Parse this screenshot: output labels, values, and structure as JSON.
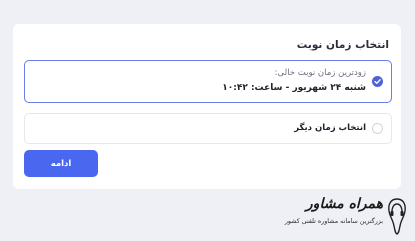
{
  "page": {
    "title": "انتخاب زمان نوبت"
  },
  "options": [
    {
      "subtitle": "زودترین زمان نوبت خالی:",
      "value": "شنبه ۲۴ شهریور - ساعت: ۱۰:۴۲",
      "selected": true
    },
    {
      "label": "انتخاب زمان دیگر",
      "selected": false
    }
  ],
  "actions": {
    "continue_label": "ادامه"
  },
  "brand": {
    "name": "همراه مشاور",
    "tagline": "بزرگترین سامانه مشاوره تلفنی کشور"
  },
  "colors": {
    "background": "#eef0f6",
    "accent": "#4a67f0",
    "selected_border": "#6a7de6"
  }
}
